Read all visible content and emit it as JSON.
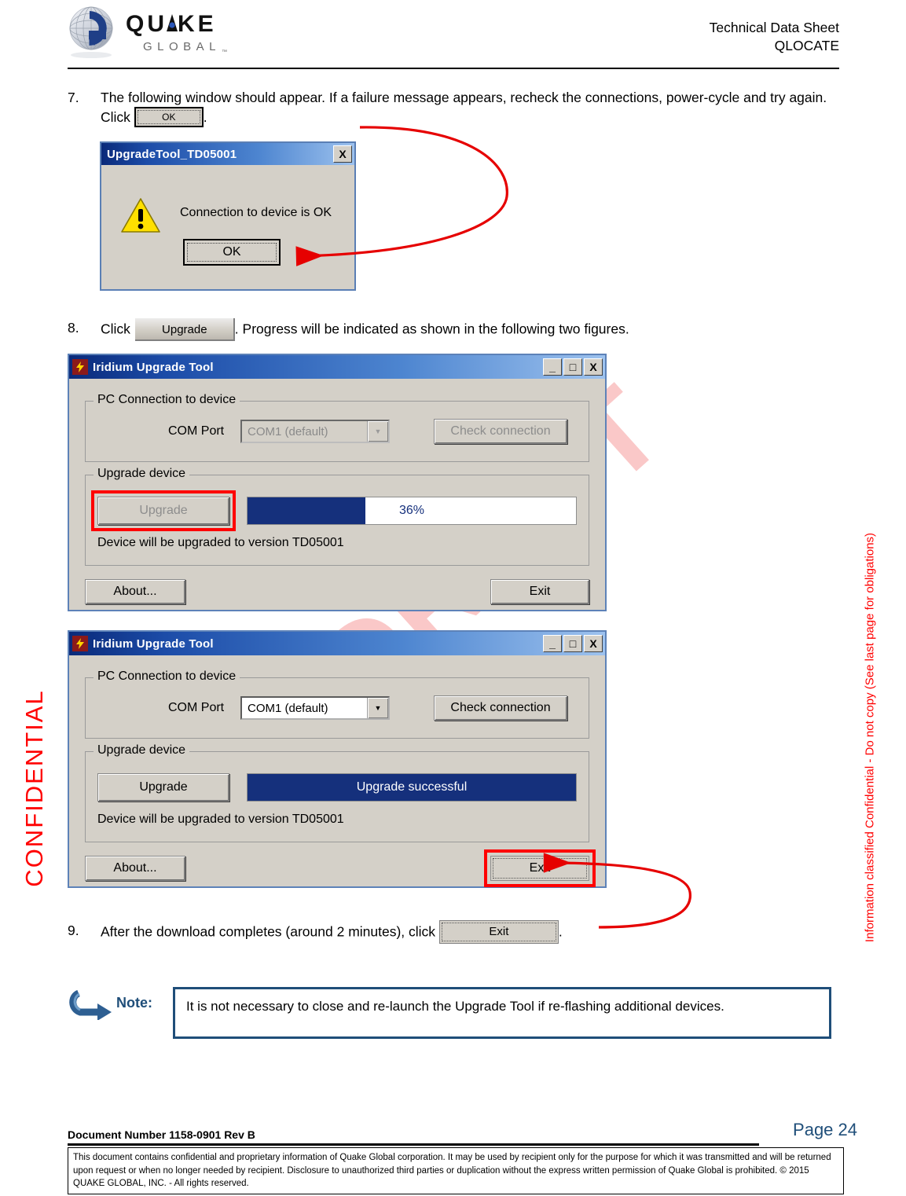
{
  "header": {
    "logo_primary": "QUAKE",
    "logo_secondary": "G L O B A L",
    "doc_type": "Technical Data Sheet",
    "product": "QLOCATE"
  },
  "watermark": {
    "text": "DRAFT"
  },
  "side_text": {
    "left": "CONFIDENTIAL",
    "right": "Information classified Confidential - Do not copy (See last page for obligations)"
  },
  "steps": {
    "step7": {
      "number": "7.",
      "text_before": "The following window should appear.  If a failure message appears, recheck the connections, power-cycle and try again.  Click",
      "inline_button": "OK",
      "text_after": "."
    },
    "step8": {
      "number": "8.",
      "text_before": "Click",
      "inline_button": "Upgrade",
      "text_after": ".  Progress will be indicated as shown in the following two figures."
    },
    "step9": {
      "number": "9.",
      "text_before": "After the download completes (around 2 minutes), click",
      "inline_button": "Exit",
      "text_after": "."
    }
  },
  "dialog_msgbox": {
    "title": "UpgradeTool_TD05001",
    "close_label": "X",
    "icon": "warning-triangle-icon",
    "message": "Connection to device is OK",
    "ok_label": "OK"
  },
  "upgrade_window_progress": {
    "title": "Iridium Upgrade Tool",
    "app_icon": "lightning-bolt-icon",
    "minimize_label": "_",
    "maximize_label": "□",
    "close_label": "X",
    "group_connection": "PC Connection to device",
    "com_port_label": "COM Port",
    "com_port_value": "COM1  (default)",
    "check_connection_label": "Check connection",
    "group_upgrade": "Upgrade device",
    "upgrade_label": "Upgrade",
    "progress_percent": 36,
    "progress_text": "36%",
    "status_text": "Device will be upgraded to version TD05001",
    "about_label": "About...",
    "exit_label": "Exit",
    "highlighted_control": "upgrade-button"
  },
  "upgrade_window_success": {
    "title": "Iridium Upgrade Tool",
    "app_icon": "lightning-bolt-icon",
    "minimize_label": "_",
    "maximize_label": "□",
    "close_label": "X",
    "group_connection": "PC Connection to device",
    "com_port_label": "COM Port",
    "com_port_value": "COM1  (default)",
    "check_connection_label": "Check connection",
    "group_upgrade": "Upgrade device",
    "upgrade_label": "Upgrade",
    "progress_percent": 100,
    "progress_text": "Upgrade successful",
    "status_text": "Device will be upgraded to version TD05001",
    "about_label": "About...",
    "exit_label": "Exit",
    "highlighted_control": "exit-button"
  },
  "note": {
    "icon": "curved-arrow-icon",
    "label": "Note:",
    "text": "It is not necessary to close and re-launch the Upgrade Tool if re-flashing additional devices."
  },
  "footer": {
    "document_number": "Document Number 1158-0901   Rev B",
    "page": "Page 24",
    "legal": "This document contains confidential and proprietary information of Quake Global corporation.  It may be used by recipient only for the purpose for which it was transmitted and will be returned upon request or when no longer needed by recipient.  Disclosure to unauthorized third parties or duplication without the express written permission of Quake Global is prohibited.  © 2015   QUAKE GLOBAL, INC. - All rights reserved."
  },
  "colors": {
    "accent_blue": "#1f4e79",
    "highlight_red": "#ff0000",
    "progress_blue": "#15307c",
    "titlebar_blue": "#0a2a7a"
  }
}
